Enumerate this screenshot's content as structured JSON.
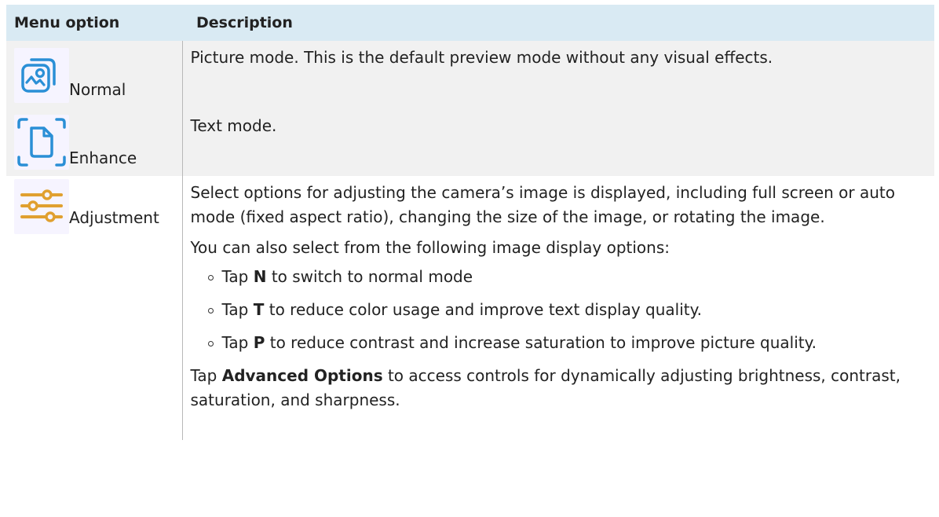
{
  "table": {
    "headers": [
      "Menu option",
      "Description"
    ],
    "rows": [
      {
        "icon": "picture-mode-icon",
        "label": "Normal",
        "description": "Picture mode. This is the default preview mode without any visual effects."
      },
      {
        "icon": "text-mode-icon",
        "label": "Enhance",
        "description": "Text mode."
      },
      {
        "icon": "sliders-icon",
        "label": "Adjustment",
        "description": "Select options for adjusting the camera’s image is displayed, including full screen or auto mode (fixed aspect ratio), changing the size of the image, or rotating the image.",
        "intro": "You can also select from the following image display options:",
        "bullets": [
          {
            "pre": "Tap ",
            "key": "N",
            "post": " to switch to normal mode"
          },
          {
            "pre": "Tap ",
            "key": "T",
            "post": " to reduce color usage and improve text display quality."
          },
          {
            "pre": "Tap ",
            "key": "P",
            "post": " to reduce contrast and increase saturation to improve picture quality."
          }
        ],
        "tail": {
          "pre": "Tap ",
          "key": "Advanced Options",
          "post": " to access controls for dynamically adjusting brightness, contrast, saturation, and sharpness."
        }
      }
    ]
  },
  "colors": {
    "header_bg": "#d9eaf3",
    "shaded_row": "#f1f1f1",
    "icon_blue": "#2a8fd6",
    "icon_gold": "#e0a030"
  }
}
